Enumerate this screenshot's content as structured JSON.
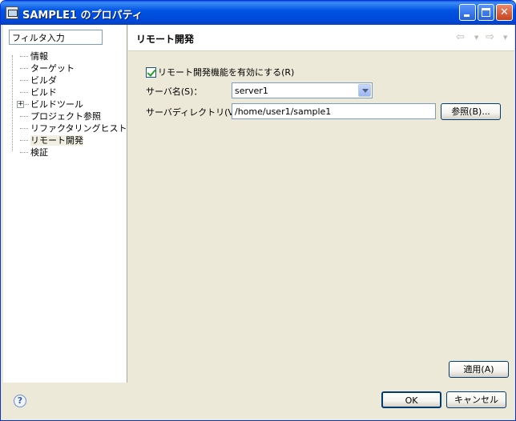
{
  "window": {
    "title": "SAMPLE1 のプロパティ"
  },
  "filter": {
    "value": "フィルタ入力"
  },
  "tree": {
    "items": [
      {
        "label": "情報"
      },
      {
        "label": "ターゲット"
      },
      {
        "label": "ビルダ"
      },
      {
        "label": "ビルド"
      },
      {
        "label": "ビルドツール",
        "expandable": true
      },
      {
        "label": "プロジェクト参照"
      },
      {
        "label": "リファクタリングヒストリ"
      },
      {
        "label": "リモート開発",
        "selected": true
      },
      {
        "label": "検証"
      }
    ]
  },
  "page": {
    "title": "リモート開発",
    "enable_label": "リモート開発機能を有効にする(R)",
    "enable_checked": true,
    "server_label": "サーバ名(S)：",
    "server_value": "server1",
    "dir_label": "サーバディレクトリ(V)：",
    "dir_value": "/home/user1/sample1",
    "browse_label": "参照(B)...",
    "apply_label": "適用(A)"
  },
  "footer": {
    "ok_label": "OK",
    "cancel_label": "キャンセル"
  },
  "icons": {
    "back": "back-arrow-icon",
    "forward": "forward-arrow-icon",
    "help": "help-icon"
  }
}
